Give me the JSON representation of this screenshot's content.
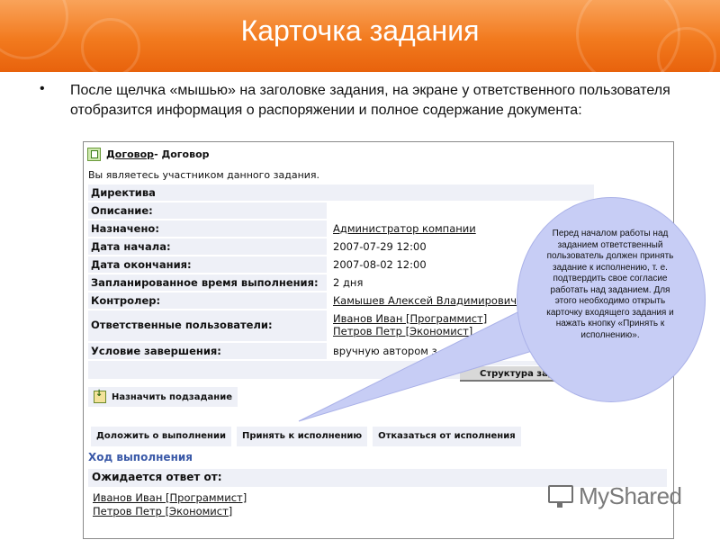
{
  "slide": {
    "title": "Карточка задания",
    "bullet": "•",
    "intro": "После щелчка «мышью» на заголовке задания, на экране у ответственного пользователя отобразится информация о распоряжении и полное содержание документа:"
  },
  "card": {
    "doc_link": "Договор",
    "doc_title": " - Договор",
    "participant_text": "Вы являетесь участником данного задания.",
    "section_header": "Директива",
    "fields": [
      {
        "label": "Описание:",
        "value": ""
      },
      {
        "label": "Назначено:",
        "value": "Администратор компании"
      },
      {
        "label": "Дата начала:",
        "value": "2007-07-29 12:00"
      },
      {
        "label": "Дата окончания:",
        "value": "2007-08-02 12:00"
      },
      {
        "label": "Запланированное время выполнения:",
        "value": "2 дня"
      },
      {
        "label": "Контролер:",
        "value": "Камышев Алексей Владимирович"
      },
      {
        "label": "Ответственные пользователи:",
        "value": "Иванов Иван [Программист]",
        "value2": "Петров Петр [Экономист]"
      },
      {
        "label": "Условие завершения:",
        "value": "вручную автором з"
      }
    ],
    "structure_button": "Структура зад",
    "assign_subtask_button": "Назначить подзадание",
    "actions": [
      "Доложить о выполнении",
      "Принять к исполнению",
      "Отказаться от исполнения"
    ],
    "progress_title": "Ход выполнения",
    "await_label": "Ожидается ответ от:",
    "await_people": [
      "Иванов Иван [Программист]",
      "Петров Петр [Экономист]"
    ]
  },
  "callout": {
    "text": "Перед началом работы над заданием ответственный пользователь должен принять задание к исполнению, т. е. подтвердить свое согласие работать над заданием. Для этого необходимо открыть карточку входящего задания и нажать кнопку «Принять к исполнению»."
  },
  "watermark": {
    "text": "MyShared",
    "icon": "presentation-screen-icon"
  },
  "colors": {
    "banner": "#f27a1e",
    "label_bg": "#eef0f7",
    "progress_title": "#3a59a8",
    "bubble": "#c7cdf5"
  }
}
